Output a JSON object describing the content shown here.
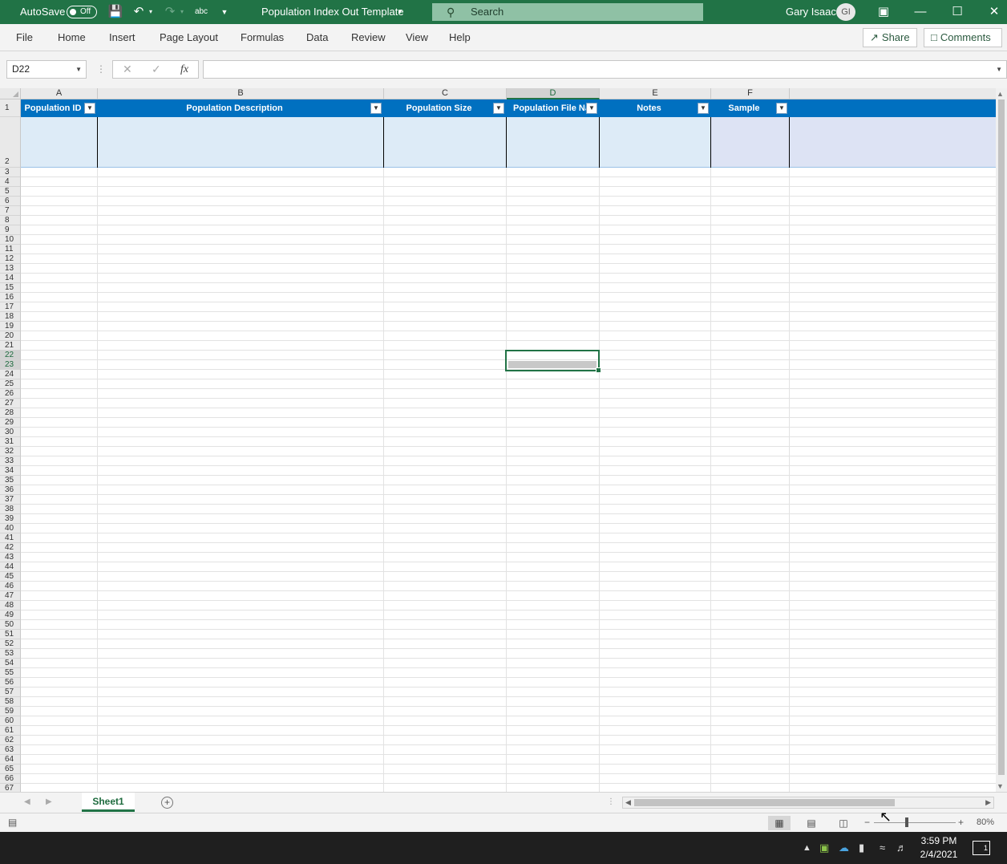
{
  "titlebar": {
    "autosave_label": "AutoSave",
    "autosave_state": "Off",
    "document_title": "Population Index Out Template",
    "search_placeholder": "Search",
    "user_name": "Gary Isaac",
    "user_initials": "GI"
  },
  "ribbon": {
    "tabs": [
      "File",
      "Home",
      "Insert",
      "Page Layout",
      "Formulas",
      "Data",
      "Review",
      "View",
      "Help"
    ],
    "share_label": "Share",
    "comments_label": "Comments"
  },
  "formula_bar": {
    "name_box": "D22",
    "fx_label": "fx",
    "formula": ""
  },
  "sheet": {
    "columns": [
      "A",
      "B",
      "C",
      "D",
      "E",
      "F"
    ],
    "selected_column": "D",
    "table_headers": [
      "Population ID",
      "Population Description",
      "Population Size",
      "Population File Nan",
      "Notes",
      "Sample"
    ],
    "row_labels": [
      "1",
      "2",
      "3",
      "4",
      "5",
      "6",
      "7",
      "8",
      "9",
      "10",
      "11",
      "12",
      "13",
      "14",
      "15",
      "16",
      "17",
      "18",
      "19",
      "20",
      "21",
      "22",
      "23",
      "24",
      "25",
      "26",
      "27",
      "28",
      "29",
      "30",
      "31",
      "32",
      "33",
      "34",
      "35",
      "36",
      "37",
      "38",
      "39",
      "40",
      "41",
      "42",
      "43",
      "44",
      "45",
      "46",
      "47",
      "48",
      "49",
      "50",
      "51",
      "52",
      "53",
      "54",
      "55",
      "56",
      "57",
      "58",
      "59",
      "60",
      "61",
      "62",
      "63",
      "64",
      "65",
      "66",
      "67"
    ],
    "selected_rows": [
      "22",
      "23"
    ],
    "header_color": "#0070c0",
    "band_color": "#ddebf7"
  },
  "sheet_tabs": {
    "active": "Sheet1"
  },
  "status": {
    "zoom": "80%"
  },
  "taskbar": {
    "time": "3:59 PM",
    "date": "2/4/2021",
    "notifications": "1"
  },
  "accent_color": "#217346"
}
